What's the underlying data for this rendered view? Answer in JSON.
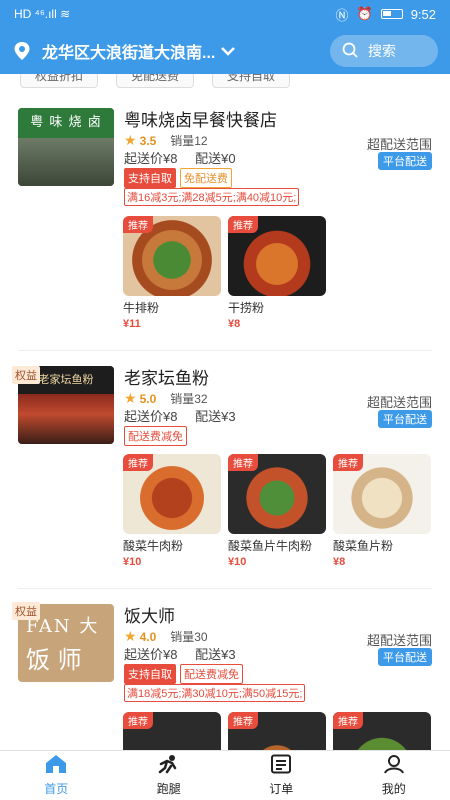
{
  "status": {
    "left": "HD ⁴⁶.ıll ≋",
    "time": "9:52",
    "icons": [
      "nfc-icon",
      "alarm-icon",
      "battery-icon"
    ]
  },
  "header": {
    "location": "龙华区大浪街道大浪南...",
    "search_label": "搜索"
  },
  "filters": [
    "权益折扣",
    "免配送费",
    "支持自取"
  ],
  "stores": [
    {
      "name": "粤味烧卤早餐快餐店",
      "rating": "3.5",
      "sales": "销量12",
      "min_order": "起送价¥8",
      "delivery": "配送¥0",
      "range": "超配送范围",
      "platform": "平台配送",
      "rights": "",
      "tags": [
        {
          "text": "支持自取",
          "style": "redfill"
        },
        {
          "text": "免配送费",
          "style": "orange"
        }
      ],
      "promo": "满16减3元;满28减5元;满40减10元;",
      "dishes": [
        {
          "badge": "推荐",
          "name": "牛排粉",
          "price": "¥11"
        },
        {
          "badge": "推荐",
          "name": "干捞粉",
          "price": "¥8"
        }
      ]
    },
    {
      "name": "老家坛鱼粉",
      "rating": "5.0",
      "sales": "销量32",
      "min_order": "起送价¥8",
      "delivery": "配送¥3",
      "range": "超配送范围",
      "platform": "平台配送",
      "rights": "权益",
      "tags": [
        {
          "text": "配送费减免",
          "style": "red"
        }
      ],
      "promo": "",
      "dishes": [
        {
          "badge": "推荐",
          "name": "酸菜牛肉粉",
          "price": "¥10"
        },
        {
          "badge": "推荐",
          "name": "酸菜鱼片牛肉粉",
          "price": "¥10"
        },
        {
          "badge": "推荐",
          "name": "酸菜鱼片粉",
          "price": "¥8"
        }
      ]
    },
    {
      "name": "饭大师",
      "rating": "4.0",
      "sales": "销量30",
      "min_order": "起送价¥8",
      "delivery": "配送¥3",
      "range": "超配送范围",
      "platform": "平台配送",
      "rights": "权益",
      "tags": [
        {
          "text": "支持自取",
          "style": "redfill"
        },
        {
          "text": "配送费减免",
          "style": "red"
        }
      ],
      "promo": "满18减5元;满30减10元;满50减15元;",
      "dishes": [
        {
          "badge": "推荐",
          "name": "",
          "price": ""
        },
        {
          "badge": "推荐",
          "name": "",
          "price": ""
        },
        {
          "badge": "推荐",
          "name": "",
          "price": ""
        }
      ]
    }
  ],
  "thumb_text": {
    "store1": "粤 味 烧 卤",
    "store2": "老家坛鱼粉",
    "store3_en": "FAN 大",
    "store3_cn": "饭 师"
  },
  "tabs": [
    {
      "label": "首页",
      "icon": "home-icon",
      "active": true
    },
    {
      "label": "跑腿",
      "icon": "errand-icon",
      "active": false
    },
    {
      "label": "订单",
      "icon": "order-icon",
      "active": false
    },
    {
      "label": "我的",
      "icon": "profile-icon",
      "active": false
    }
  ],
  "colors": {
    "primary": "#3d9ae8",
    "price": "#e74c3c",
    "star": "#f3a531"
  }
}
